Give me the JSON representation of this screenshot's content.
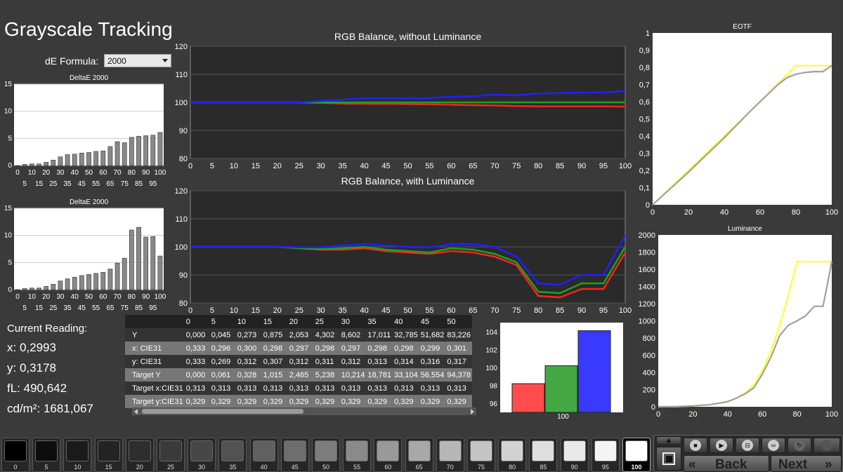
{
  "page_title": "Grayscale Tracking",
  "formula": {
    "label": "dE Formula:",
    "value": "2000"
  },
  "chart_data": [
    {
      "type": "bar",
      "title": "DeltaE 2000",
      "categories": [
        "0",
        "5",
        "10",
        "15",
        "20",
        "25",
        "30",
        "35",
        "40",
        "45",
        "50",
        "55",
        "60",
        "65",
        "70",
        "75",
        "80",
        "85",
        "90",
        "95",
        "100"
      ],
      "values": [
        0,
        0.2,
        0.3,
        0.3,
        0.6,
        1.0,
        1.6,
        2.0,
        2.1,
        2.3,
        2.4,
        2.6,
        2.7,
        3.5,
        4.4,
        4.2,
        5.2,
        5.4,
        5.5,
        5.6,
        6.1
      ],
      "ylim": [
        0,
        15
      ],
      "yticks": [
        "0",
        "5",
        "10",
        "15"
      ],
      "xticks_top": [
        "0",
        "10",
        "20",
        "30",
        "40",
        "50",
        "60",
        "70",
        "80",
        "90",
        "100"
      ],
      "xticks_bottom": [
        "5",
        "15",
        "25",
        "35",
        "45",
        "55",
        "65",
        "75",
        "85",
        "95"
      ]
    },
    {
      "type": "bar",
      "title": "DeltaE 2000",
      "categories": [
        "0",
        "5",
        "10",
        "15",
        "20",
        "25",
        "30",
        "35",
        "40",
        "45",
        "50",
        "55",
        "60",
        "65",
        "70",
        "75",
        "80",
        "85",
        "90",
        "95",
        "100"
      ],
      "values": [
        0,
        0.2,
        0.3,
        0.3,
        0.6,
        1.0,
        1.6,
        2.0,
        2.3,
        2.6,
        2.8,
        3.0,
        3.2,
        3.8,
        4.9,
        5.8,
        11.0,
        11.5,
        9.7,
        9.8,
        6.2
      ],
      "ylim": [
        0,
        15
      ],
      "yticks": [
        "0",
        "5",
        "10",
        "15"
      ],
      "xticks_top": [
        "0",
        "10",
        "20",
        "30",
        "40",
        "50",
        "60",
        "70",
        "80",
        "90",
        "100"
      ],
      "xticks_bottom": [
        "5",
        "15",
        "25",
        "35",
        "45",
        "55",
        "65",
        "75",
        "85",
        "95"
      ]
    },
    {
      "type": "line",
      "title": "RGB Balance, without Luminance",
      "x": [
        0,
        5,
        10,
        15,
        20,
        25,
        30,
        35,
        40,
        45,
        50,
        55,
        60,
        65,
        70,
        75,
        80,
        85,
        90,
        95,
        100
      ],
      "series": [
        {
          "color": "#ff2020",
          "values": [
            100,
            100,
            100,
            100,
            100,
            100,
            99.8,
            99.6,
            99.5,
            99.5,
            99.4,
            99.3,
            99.2,
            99.0,
            98.9,
            98.7,
            98.6,
            98.6,
            98.6,
            98.6,
            98.5
          ]
        },
        {
          "color": "#20a020",
          "values": [
            100,
            100,
            100,
            100,
            100,
            100,
            100,
            100,
            100,
            100,
            100,
            100,
            100,
            100,
            100,
            100,
            100,
            100,
            100,
            100,
            100
          ]
        },
        {
          "color": "#2020ff",
          "values": [
            100,
            100,
            100,
            100,
            100,
            100,
            100.5,
            101,
            101.5,
            101.5,
            101.5,
            101.5,
            102,
            102.2,
            102.8,
            102.5,
            103.2,
            103.3,
            103.5,
            103.6,
            104
          ]
        }
      ],
      "ylim": [
        80,
        120
      ],
      "yticks": [
        "80",
        "90",
        "100",
        "110",
        "120"
      ],
      "xticks": [
        "0",
        "5",
        "10",
        "15",
        "20",
        "25",
        "30",
        "35",
        "40",
        "45",
        "50",
        "55",
        "60",
        "65",
        "70",
        "75",
        "80",
        "85",
        "90",
        "95",
        "100"
      ]
    },
    {
      "type": "line",
      "title": "RGB Balance, with Luminance",
      "x": [
        0,
        5,
        10,
        15,
        20,
        25,
        30,
        35,
        40,
        45,
        50,
        55,
        60,
        65,
        70,
        75,
        80,
        85,
        90,
        95,
        100
      ],
      "series": [
        {
          "color": "#ff2020",
          "values": [
            100,
            100,
            100,
            100,
            100,
            99.5,
            99,
            99,
            99.5,
            98.5,
            98,
            97.5,
            98.5,
            98,
            96.5,
            93.5,
            82.5,
            82,
            85,
            85,
            98
          ]
        },
        {
          "color": "#20a020",
          "values": [
            100,
            100,
            100,
            100,
            100,
            99.5,
            99.2,
            99.5,
            100,
            99,
            98.5,
            98,
            99.5,
            99,
            97.5,
            94.5,
            84,
            83.5,
            87,
            87,
            100
          ]
        },
        {
          "color": "#2020ff",
          "values": [
            100,
            100,
            100,
            100,
            100,
            99.8,
            99.8,
            100.5,
            101,
            100.5,
            100,
            99.8,
            101,
            101,
            100,
            96.5,
            87,
            86.5,
            90,
            90,
            104
          ]
        }
      ],
      "ylim": [
        80,
        120
      ],
      "yticks": [
        "80",
        "90",
        "100",
        "110",
        "120"
      ],
      "xticks": [
        "0",
        "5",
        "10",
        "15",
        "20",
        "25",
        "30",
        "35",
        "40",
        "45",
        "50",
        "55",
        "60",
        "65",
        "70",
        "75",
        "80",
        "85",
        "90",
        "95",
        "100"
      ]
    },
    {
      "type": "line",
      "title": "EOTF",
      "series": [
        {
          "color": "#ffff33",
          "x": [
            0,
            20,
            40,
            60,
            80,
            100
          ],
          "values": [
            0,
            0.2,
            0.4,
            0.6,
            0.81,
            0.81
          ]
        },
        {
          "color": "#a0a0a0",
          "x": [
            0,
            20,
            40,
            55,
            60,
            70,
            75,
            80,
            85,
            90,
            95,
            100
          ],
          "values": [
            0,
            0.19,
            0.39,
            0.55,
            0.6,
            0.7,
            0.74,
            0.76,
            0.77,
            0.775,
            0.775,
            0.81
          ]
        }
      ],
      "xlim": [
        0,
        100
      ],
      "ylim": [
        0,
        1
      ],
      "yticks": [
        "0",
        "0,1",
        "0,2",
        "0,3",
        "0,4",
        "0,5",
        "0,6",
        "0,7",
        "0,8",
        "0,9",
        "1"
      ],
      "xticks": [
        "0",
        "20",
        "40",
        "60",
        "80",
        "100"
      ]
    },
    {
      "type": "line",
      "title": "Luminance",
      "series": [
        {
          "color": "#ffff33",
          "x": [
            0,
            10,
            20,
            30,
            40,
            45,
            50,
            55,
            60,
            65,
            70,
            75,
            80,
            82,
            85,
            100
          ],
          "values": [
            0,
            2,
            10,
            25,
            60,
            100,
            160,
            250,
            420,
            650,
            950,
            1300,
            1690,
            1690,
            1690,
            1690
          ]
        },
        {
          "color": "#a0a0a0",
          "x": [
            0,
            10,
            20,
            30,
            40,
            45,
            50,
            55,
            60,
            65,
            70,
            75,
            80,
            85,
            90,
            95,
            100
          ],
          "values": [
            0,
            2,
            10,
            25,
            60,
            100,
            150,
            220,
            380,
            580,
            830,
            950,
            1000,
            1060,
            1170,
            1170,
            1690
          ]
        }
      ],
      "xlim": [
        0,
        100
      ],
      "ylim": [
        0,
        2000
      ],
      "yticks": [
        "0",
        "200",
        "400",
        "600",
        "800",
        "1000",
        "1200",
        "1400",
        "1600",
        "1800",
        "2000"
      ],
      "xticks": [
        "0",
        "20",
        "40",
        "60",
        "80",
        "100"
      ]
    },
    {
      "type": "bar",
      "categories": [
        "100"
      ],
      "series": [
        {
          "color": "#ff4d4d",
          "values": [
            98.2
          ]
        },
        {
          "color": "#43a843",
          "values": [
            100.2
          ]
        },
        {
          "color": "#3a3aff",
          "values": [
            104.1
          ]
        }
      ],
      "ylim": [
        95,
        105
      ],
      "yticks": [
        "96",
        "98",
        "100",
        "102",
        "104"
      ]
    }
  ],
  "reading": {
    "heading": "Current Reading:",
    "x": "x: 0,2993",
    "y": "y: 0,3178",
    "fl": "fL: 490,642",
    "cd": "cd/m²: 1681,067"
  },
  "table": {
    "columns": [
      "0",
      "5",
      "10",
      "15",
      "20",
      "25",
      "30",
      "35",
      "40",
      "45",
      "50"
    ],
    "rows": [
      {
        "label": "Y",
        "cells": [
          "0,000",
          "0,045",
          "0,273",
          "0,875",
          "2,053",
          "4,302",
          "8,602",
          "17,011",
          "32,785",
          "51,682",
          "83,226"
        ]
      },
      {
        "label": "x: CIE31",
        "cells": [
          "0,333",
          "0,296",
          "0,300",
          "0,298",
          "0,297",
          "0,298",
          "0,297",
          "0,298",
          "0,298",
          "0,299",
          "0,301"
        ]
      },
      {
        "label": "y: CIE31",
        "cells": [
          "0,333",
          "0,269",
          "0,312",
          "0,307",
          "0,312",
          "0,311",
          "0,312",
          "0,313",
          "0,314",
          "0,316",
          "0,317"
        ]
      },
      {
        "label": "Target Y",
        "cells": [
          "0,000",
          "0,061",
          "0,328",
          "1,015",
          "2,465",
          "5,238",
          "10,214",
          "18,781",
          "33,104",
          "56,554",
          "94,378"
        ]
      },
      {
        "label": "Target x:CIE31",
        "cells": [
          "0,313",
          "0,313",
          "0,313",
          "0,313",
          "0,313",
          "0,313",
          "0,313",
          "0,313",
          "0,313",
          "0,313",
          "0,313"
        ]
      },
      {
        "label": "Target y:CIE31",
        "cells": [
          "0,329",
          "0,329",
          "0,329",
          "0,329",
          "0,329",
          "0,329",
          "0,329",
          "0,329",
          "0,329",
          "0,329",
          "0,329"
        ]
      }
    ]
  },
  "swatches": [
    {
      "label": "0",
      "color": "#000000"
    },
    {
      "label": "5",
      "color": "#0d0d0d"
    },
    {
      "label": "10",
      "color": "#1a1a1a"
    },
    {
      "label": "15",
      "color": "#232323"
    },
    {
      "label": "20",
      "color": "#2e2e2e"
    },
    {
      "label": "25",
      "color": "#3a3a3a"
    },
    {
      "label": "30",
      "color": "#474747"
    },
    {
      "label": "35",
      "color": "#525252"
    },
    {
      "label": "40",
      "color": "#606060"
    },
    {
      "label": "45",
      "color": "#6e6e6e"
    },
    {
      "label": "50",
      "color": "#7c7c7c"
    },
    {
      "label": "55",
      "color": "#8a8a8a"
    },
    {
      "label": "60",
      "color": "#999999"
    },
    {
      "label": "65",
      "color": "#a8a8a8"
    },
    {
      "label": "70",
      "color": "#b6b6b6"
    },
    {
      "label": "75",
      "color": "#c4c4c4"
    },
    {
      "label": "80",
      "color": "#d2d2d2"
    },
    {
      "label": "85",
      "color": "#dedede"
    },
    {
      "label": "90",
      "color": "#e9e9e9"
    },
    {
      "label": "95",
      "color": "#f4f4f4"
    },
    {
      "label": "100",
      "color": "#ffffff"
    }
  ],
  "active_swatch": "100",
  "nav": {
    "back": "Back",
    "next": "Next"
  },
  "icons": [
    "up-arrow-icon",
    "stop-icon",
    "stop-circle-icon",
    "play-icon",
    "frame-icon",
    "loop-icon",
    "refresh-icon",
    "record-icon"
  ]
}
